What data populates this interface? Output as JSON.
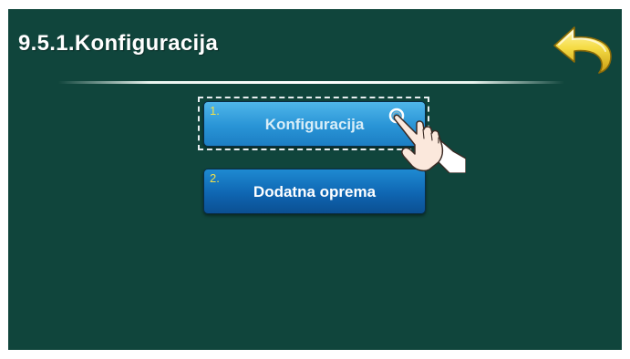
{
  "screen": {
    "title": "9.5.1.Konfiguracija",
    "back_button": {
      "icon": "back-arrow-icon",
      "color": "#f2d33a"
    }
  },
  "menu": {
    "items": [
      {
        "number": "1.",
        "label": "Konfiguracija",
        "state": "selected"
      },
      {
        "number": "2.",
        "label": "Dodatna oprema",
        "state": "normal"
      }
    ]
  },
  "pointer": {
    "icon": "hand-pointer-icon"
  },
  "colors": {
    "background": "#10453c",
    "button_selected": "#2994d6",
    "button_normal": "#0f66b2",
    "number_text": "#f1e04a"
  }
}
